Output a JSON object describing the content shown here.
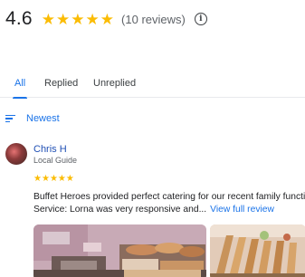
{
  "summary": {
    "rating": "4.6",
    "stars_filled": 5,
    "review_count": "(10 reviews)",
    "info_icon": "info-icon"
  },
  "tabs": [
    {
      "label": "All",
      "active": true
    },
    {
      "label": "Replied",
      "active": false
    },
    {
      "label": "Unreplied",
      "active": false
    }
  ],
  "sort": {
    "label": "Newest",
    "icon": "sort-icon"
  },
  "review": {
    "author": "Chris H",
    "author_subtitle": "Local Guide",
    "stars": 5,
    "text_line1": "Buffet Heroes provided perfect catering for our recent family function.",
    "text_line2": "Service: Lorna was very responsive and...",
    "view_full_label": "View full review"
  },
  "colors": {
    "accent": "#1a73e8",
    "star": "#fbbc04",
    "text": "#202124",
    "muted": "#5f6368"
  }
}
